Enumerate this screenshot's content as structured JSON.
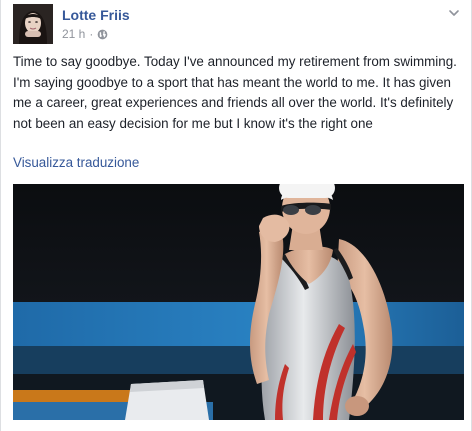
{
  "post": {
    "author": "Lotte Friis",
    "time": "21 h",
    "separator": "·",
    "privacy_icon": "globe-icon",
    "options_icon": "chevron-down-icon",
    "text": "Time to say goodbye. Today I've announced my retirement from swimming. I'm saying goodbye to a sport that has meant the world to me. It has given me a career, great experiences and friends all over the world. It's definitely not been an easy decision for me but I know it's the right one",
    "translate_link": "Visualizza traduzione"
  },
  "colors": {
    "author": "#365899",
    "text": "#1d2129",
    "meta": "#90949c",
    "link": "#365899"
  }
}
